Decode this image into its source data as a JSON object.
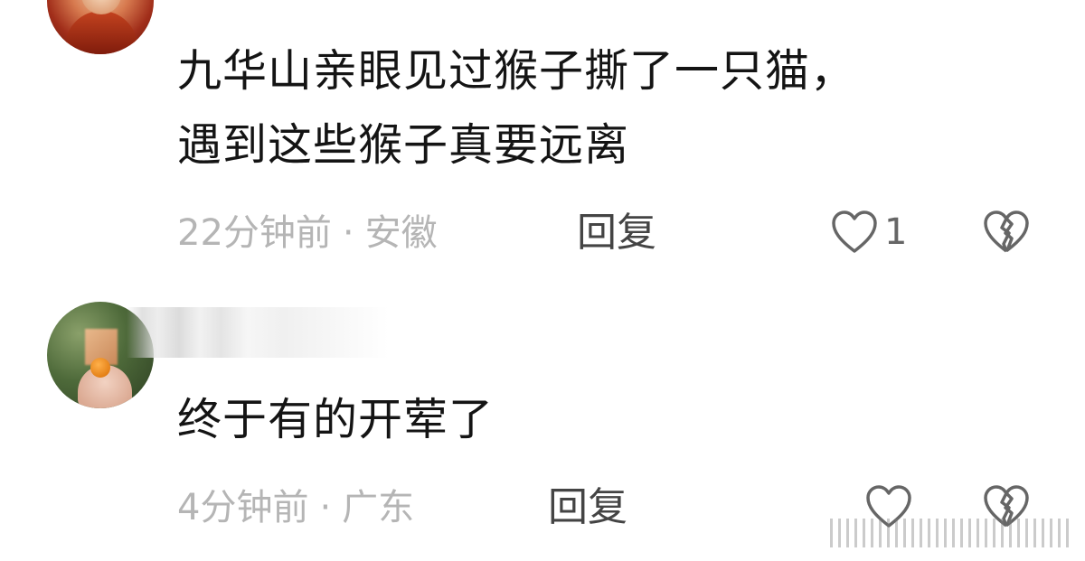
{
  "comments": [
    {
      "username": "",
      "text_line1": "九华山亲眼见过猴子撕了一只猫，",
      "text_line2": "遇到这些猴子真要远离",
      "time": "22分钟前",
      "separator": "·",
      "location": "安徽",
      "reply_label": "回复",
      "like_count": "1"
    },
    {
      "username": "",
      "text_line1": "终于有的开荤了",
      "time": "4分钟前",
      "separator": "·",
      "location": "广东",
      "reply_label": "回复",
      "like_count": ""
    }
  ],
  "colors": {
    "text": "#141414",
    "meta": "#b5b5b5",
    "reply": "#444444",
    "icon": "#666666",
    "background": "#ffffff"
  },
  "icons": {
    "like": "heart-outline-icon",
    "dislike": "broken-heart-icon"
  }
}
